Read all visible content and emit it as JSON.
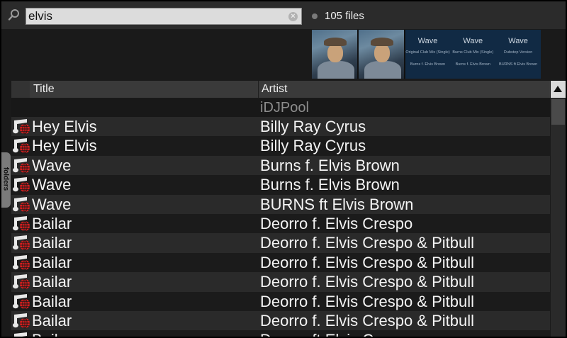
{
  "search": {
    "value": "elvis",
    "file_count": "105 files"
  },
  "covers": {
    "tiles": [
      {
        "title": "Wave",
        "sub": "Original Club Mix (Single)",
        "artist": "Burns f. Elvis Brown"
      },
      {
        "title": "Wave",
        "sub": "Burns Club Mix (Single)",
        "artist": "Burns f. Elvis Brown"
      },
      {
        "title": "Wave",
        "sub": "Dubstep Version",
        "artist": "BURNS ft Elvis Brown"
      }
    ]
  },
  "table": {
    "columns": [
      "Title",
      "Artist"
    ],
    "group": "iDJPool",
    "rows": [
      {
        "title": "Hey Elvis",
        "artist": "Billy Ray Cyrus"
      },
      {
        "title": "Hey Elvis",
        "artist": "Billy Ray Cyrus"
      },
      {
        "title": "Wave",
        "artist": "Burns f. Elvis Brown"
      },
      {
        "title": "Wave",
        "artist": "Burns f. Elvis Brown"
      },
      {
        "title": "Wave",
        "artist": "BURNS ft Elvis Brown"
      },
      {
        "title": "Bailar",
        "artist": "Deorro f. Elvis Crespo"
      },
      {
        "title": "Bailar",
        "artist": "Deorro f. Elvis Crespo & Pitbull"
      },
      {
        "title": "Bailar",
        "artist": "Deorro f. Elvis Crespo & Pitbull"
      },
      {
        "title": "Bailar",
        "artist": "Deorro f. Elvis Crespo & Pitbull"
      },
      {
        "title": "Bailar",
        "artist": "Deorro f. Elvis Crespo & Pitbull"
      },
      {
        "title": "Bailar",
        "artist": "Deorro f. Elvis Crespo & Pitbull"
      },
      {
        "title": "Bailar",
        "artist": "Deorro ft Elvis Crespo"
      }
    ]
  },
  "side_tab": {
    "label": "folders"
  },
  "icons": {
    "track": "music-note-globe-icon",
    "search": "search-icon",
    "clear": "clear-icon",
    "scroll_up": "scroll-up-arrow-icon"
  },
  "colors": {
    "background": "#1a1a1a",
    "row_alt": "#2a2a2a",
    "header": "#3a3a3a",
    "group_text": "#8c8c8c",
    "globe_red": "#d81e1e"
  }
}
